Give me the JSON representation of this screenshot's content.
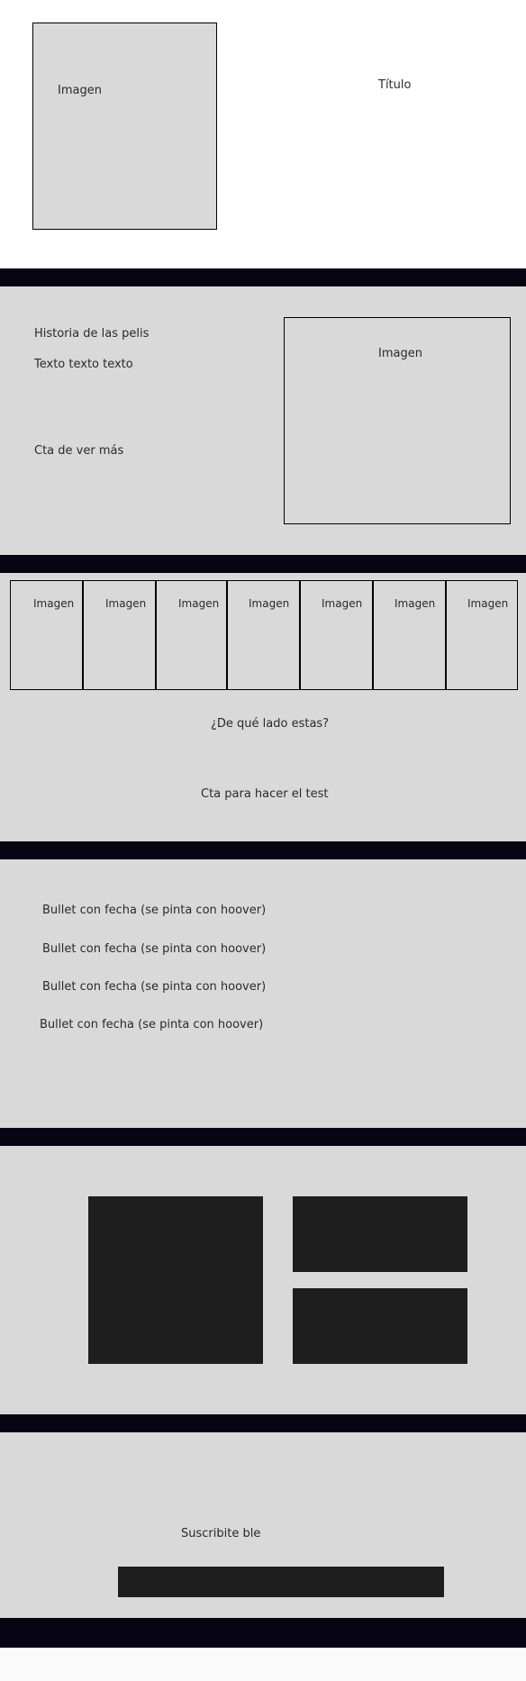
{
  "hero": {
    "image_label": "Imagen",
    "title": "Título"
  },
  "history": {
    "title": "Historia de las pelis",
    "body": "Texto texto texto",
    "cta": "Cta de ver más",
    "image_label": "Imagen"
  },
  "quiz": {
    "images": [
      "Imagen",
      "Imagen",
      "Imagen",
      "Imagen",
      "Imagen",
      "Imagen",
      "Imagen"
    ],
    "question": "¿De qué lado estas?",
    "cta": "Cta para hacer el test"
  },
  "timeline": {
    "bullets": [
      "Bullet con fecha (se pinta con hoover)",
      "Bullet con fecha (se pinta con hoover)",
      "Bullet con fecha (se pinta con hoover)",
      "Bullet con fecha (se pinta con hoover)"
    ]
  },
  "subscribe": {
    "title": "Suscribite ble"
  },
  "colors": {
    "divider": "#070514",
    "section_bg": "#d9d9d9",
    "block": "#1e1e1e"
  }
}
